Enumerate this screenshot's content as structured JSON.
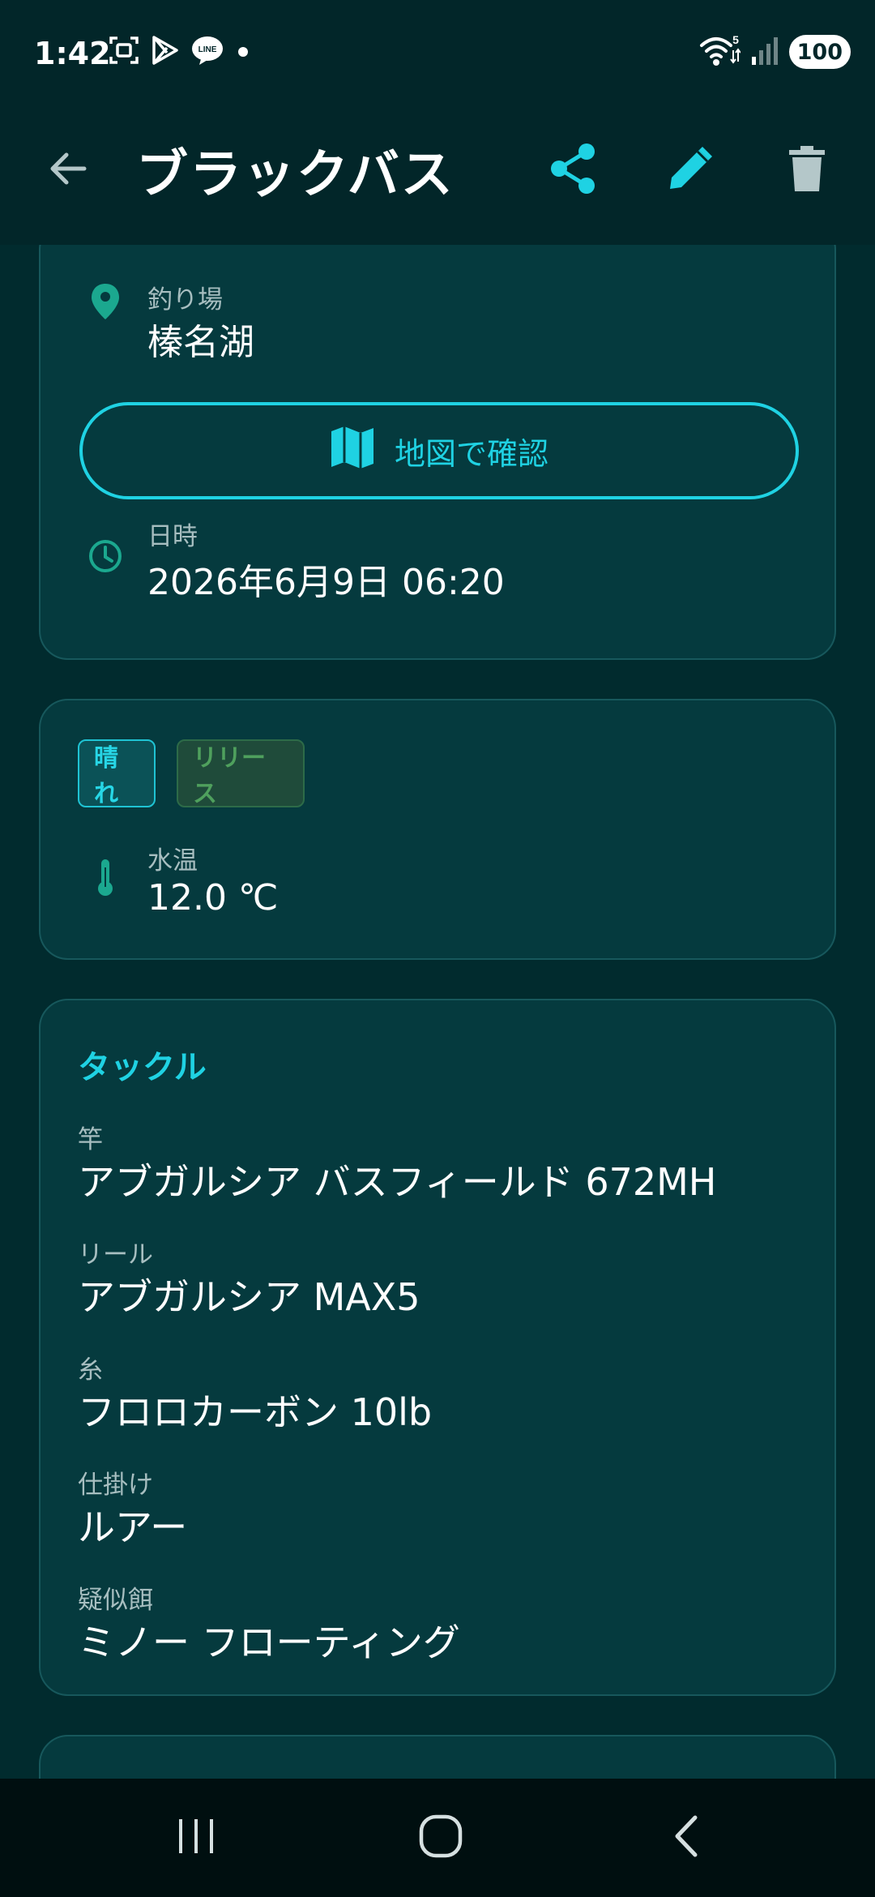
{
  "status_bar": {
    "time": "1:42",
    "battery": "100",
    "signal_badge": "5",
    "left_icons": [
      "screenshot-icon",
      "play-store-icon",
      "line-app-icon",
      "dot-icon"
    ],
    "right_icons": [
      "wifi-icon",
      "signal-icon"
    ]
  },
  "app_bar": {
    "title": "ブラックバス",
    "icons": [
      "back-arrow-icon",
      "share-icon",
      "edit-icon",
      "delete-icon"
    ],
    "accent_color": "#1fd2e3"
  },
  "location_card": {
    "place_label": "釣り場",
    "place_value": "榛名湖",
    "map_button_label": "地図で確認",
    "datetime_label": "日時",
    "datetime_value": "2026年6月9日 06:20"
  },
  "conditions_card": {
    "chips": [
      "晴れ",
      "リリース"
    ],
    "water_temp_label": "水温",
    "water_temp_value": "12.0 ℃"
  },
  "tackle_card": {
    "title": "タックル",
    "items": [
      {
        "label": "竿",
        "value": "アブガルシア バスフィールド 672MH"
      },
      {
        "label": "リール",
        "value": "アブガルシア MAX5"
      },
      {
        "label": "糸",
        "value": "フロロカーボン 10lb"
      },
      {
        "label": "仕掛け",
        "value": "ルアー"
      },
      {
        "label": "疑似餌",
        "value": "ミノー フローティング"
      }
    ]
  },
  "nav_bar": {
    "icons": [
      "recent-apps-icon",
      "home-icon",
      "back-icon"
    ]
  }
}
